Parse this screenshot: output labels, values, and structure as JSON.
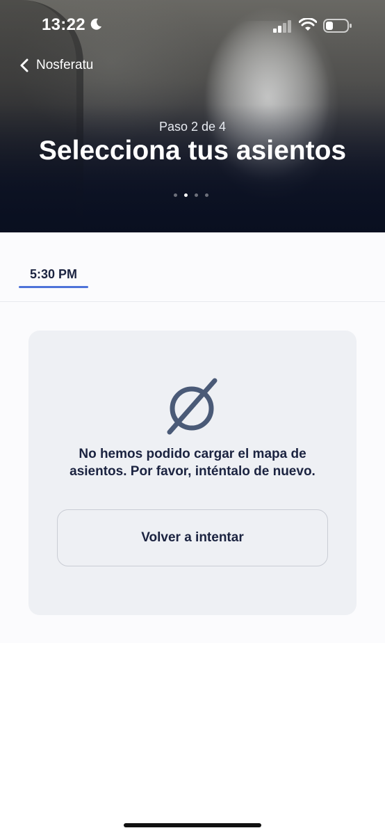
{
  "status_bar": {
    "time": "13:22"
  },
  "header": {
    "back_label": "Nosferatu",
    "step_text": "Paso 2 de 4",
    "title": "Selecciona tus asientos",
    "pager": {
      "count": 4,
      "active_index": 1
    }
  },
  "showtimes": {
    "selected": "5:30 PM"
  },
  "error_card": {
    "message": "No hemos podido cargar el mapa de asientos. Por favor, inténtalo de nuevo.",
    "retry_label": "Volver a intentar"
  },
  "colors": {
    "text_primary": "#1b2340",
    "accent": "#4d72d9",
    "icon": "#4a5a77",
    "card_bg": "#eef0f4"
  }
}
